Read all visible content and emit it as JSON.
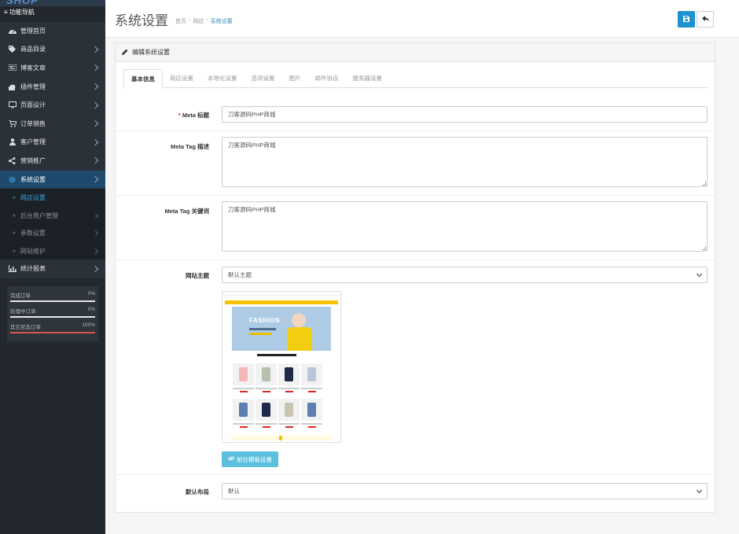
{
  "sidebar": {
    "logo_text": "SHOP",
    "nav_title": "≡ 功能导航",
    "menu": [
      {
        "label": "管理首页",
        "icon": "dashboard-icon",
        "has_arrow": false
      },
      {
        "label": "商品目录",
        "icon": "tag-icon",
        "has_arrow": true
      },
      {
        "label": "博客文章",
        "icon": "newspaper-icon",
        "has_arrow": true
      },
      {
        "label": "插件管理",
        "icon": "puzzle-icon",
        "has_arrow": true
      },
      {
        "label": "页面设计",
        "icon": "monitor-icon",
        "has_arrow": true
      },
      {
        "label": "订单销售",
        "icon": "cart-icon",
        "has_arrow": true
      },
      {
        "label": "客户管理",
        "icon": "user-icon",
        "has_arrow": true
      },
      {
        "label": "营销推广",
        "icon": "share-icon",
        "has_arrow": true
      },
      {
        "label": "系统设置",
        "icon": "gear-icon",
        "has_arrow": true,
        "active": true
      }
    ],
    "submenu": [
      {
        "label": "网店设置",
        "current": true,
        "has_arrow": false
      },
      {
        "label": "后台用户管理",
        "has_arrow": true
      },
      {
        "label": "参数设置",
        "has_arrow": true
      },
      {
        "label": "网站维护",
        "has_arrow": true
      }
    ],
    "report": {
      "label": "统计报表",
      "icon": "bar-chart-icon"
    },
    "stats": [
      {
        "label": "完成订单",
        "value": "0%",
        "fraction": 0.0,
        "color": "#e6e6e6"
      },
      {
        "label": "处理中订单",
        "value": "0%",
        "fraction": 0.0,
        "color": "#e6e6e6"
      },
      {
        "label": "其它状态订单",
        "value": "100%",
        "fraction": 1.0,
        "color": "#d9534f"
      }
    ]
  },
  "header": {
    "title": "系统设置",
    "breadcrumb": [
      "首页",
      "网店",
      "系统设置"
    ],
    "save_icon": "save-icon",
    "back_icon": "reply-icon"
  },
  "panel": {
    "heading": "编辑系统设置",
    "heading_icon": "pencil-icon",
    "tabs": [
      "基本信息",
      "商店设置",
      "本地化设置",
      "选项设置",
      "图片",
      "邮件协议",
      "服务器设置"
    ],
    "active_tab": 0
  },
  "form": {
    "meta_title_label": "Meta 标题",
    "meta_title_value": "刀客源码PHP商城",
    "meta_desc_label": "Meta Tag 描述",
    "meta_desc_value": "刀客源码PHP商城",
    "meta_keywords_label": "Meta Tag 关键词",
    "meta_keywords_value": "刀客源码PHP商城",
    "theme_label": "网站主题",
    "theme_value": "默认主题",
    "theme_preview_text": "FASHION",
    "theme_button": "前往模板设置",
    "layout_label": "默认布局",
    "layout_value": "默认"
  },
  "colors": {
    "sidebar_bg": "#23282e",
    "active_menu": "#1e4a6d",
    "primary": "#1e91cf",
    "info": "#5bc0de",
    "link": "#3c8dbc",
    "danger": "#d9534f"
  }
}
